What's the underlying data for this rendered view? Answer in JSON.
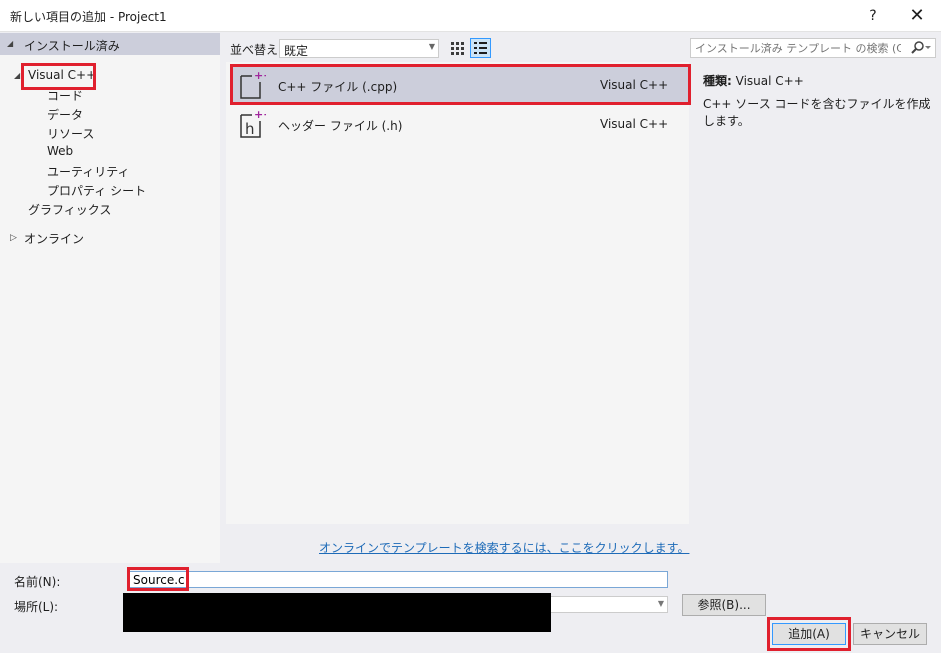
{
  "window": {
    "title": "新しい項目の追加 - Project1",
    "help_label": "?",
    "close_label": "✕"
  },
  "tree": {
    "header": "インストール済み",
    "visual_cpp": "Visual C++",
    "children": [
      "コード",
      "データ",
      "リソース",
      "Web",
      "ユーティリティ",
      "プロパティ シート"
    ],
    "graphics": "グラフィックス",
    "online": "オンライン"
  },
  "toolbar": {
    "sort_label": "並べ替え:",
    "sort_value": "既定"
  },
  "search": {
    "placeholder": "インストール済み テンプレート の検索 (Ctrl+E"
  },
  "templates": [
    {
      "name": "C++ ファイル (.cpp)",
      "language": "Visual C++",
      "icon": "cpp-file-icon",
      "selected": true
    },
    {
      "name": "ヘッダー ファイル (.h)",
      "language": "Visual C++",
      "icon": "header-file-icon",
      "selected": false
    }
  ],
  "description": {
    "type_label": "種類:",
    "type_value": "Visual C++",
    "text": "C++ ソース コードを含むファイルを作成します。"
  },
  "online_link": "オンラインでテンプレートを検索するには、ここをクリックします。",
  "form": {
    "name_label": "名前(N):",
    "name_value": "Source.c",
    "location_label": "場所(L):",
    "browse_label": "参照(B)...",
    "add_label": "追加(A)",
    "cancel_label": "キャンセル"
  },
  "colors": {
    "highlight_red": "#e0202e",
    "selection": "#cccedb",
    "link": "#1e6bb8"
  }
}
